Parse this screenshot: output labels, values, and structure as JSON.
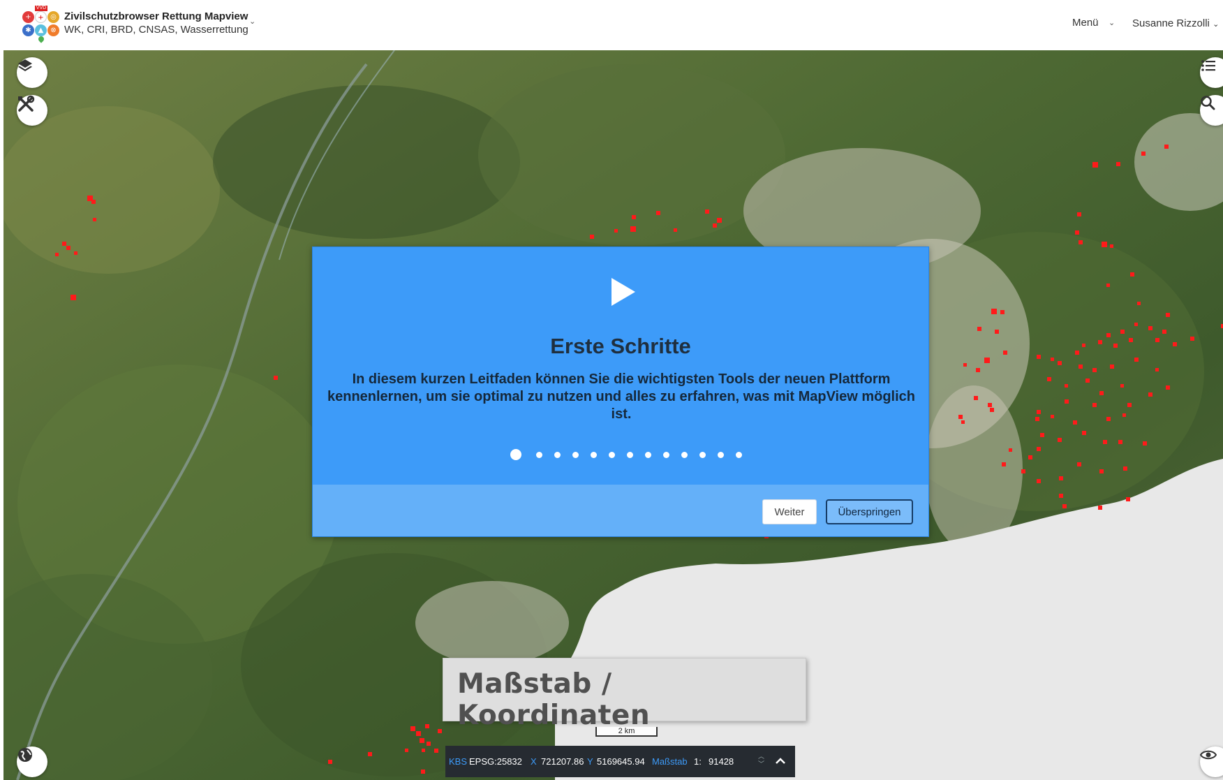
{
  "header": {
    "title": "Zivilschutzbrowser Rettung Mapview",
    "subtitle": "WK, CRI, BRD, CNSAS, Wasserrettung",
    "logo_badge": "VVD",
    "menu_label": "Menü",
    "user_label": "Susanne Rizzolli"
  },
  "dialog": {
    "title": "Erste Schritte",
    "text": "In diesem kurzen Leitfaden können Sie die wichtigsten Tools der neuen Plattform kennenlernen, um sie optimal zu nutzen und alles zu erfahren, was mit MapView möglich ist.",
    "step_count": 13,
    "current_step": 1,
    "next_label": "Weiter",
    "skip_label": "Überspringen"
  },
  "callout": {
    "text": "Maßstab / Koordinaten"
  },
  "scalebar": {
    "label": "2 km"
  },
  "coordbar": {
    "crs_label": "KBS",
    "crs_value": "EPSG:25832",
    "x_label": "X",
    "x_value": "721207.86",
    "y_label": "Y",
    "y_value": "5169645.94",
    "scale_label": "Maßstab",
    "scale_prefix": "1:",
    "scale_value": "91428"
  },
  "icons": {
    "layers": "layers-icon",
    "tools": "tools-icon",
    "legend": "list-icon",
    "search": "search-icon",
    "globe": "globe-icon",
    "visibility": "eye-icon"
  },
  "colors": {
    "dialog_bg": "#3d9bf9",
    "dialog_footer": "#64b0f9",
    "marker": "#ff1a1a",
    "coordbar_bg": "#262b31",
    "accent": "#3d9bf9"
  }
}
